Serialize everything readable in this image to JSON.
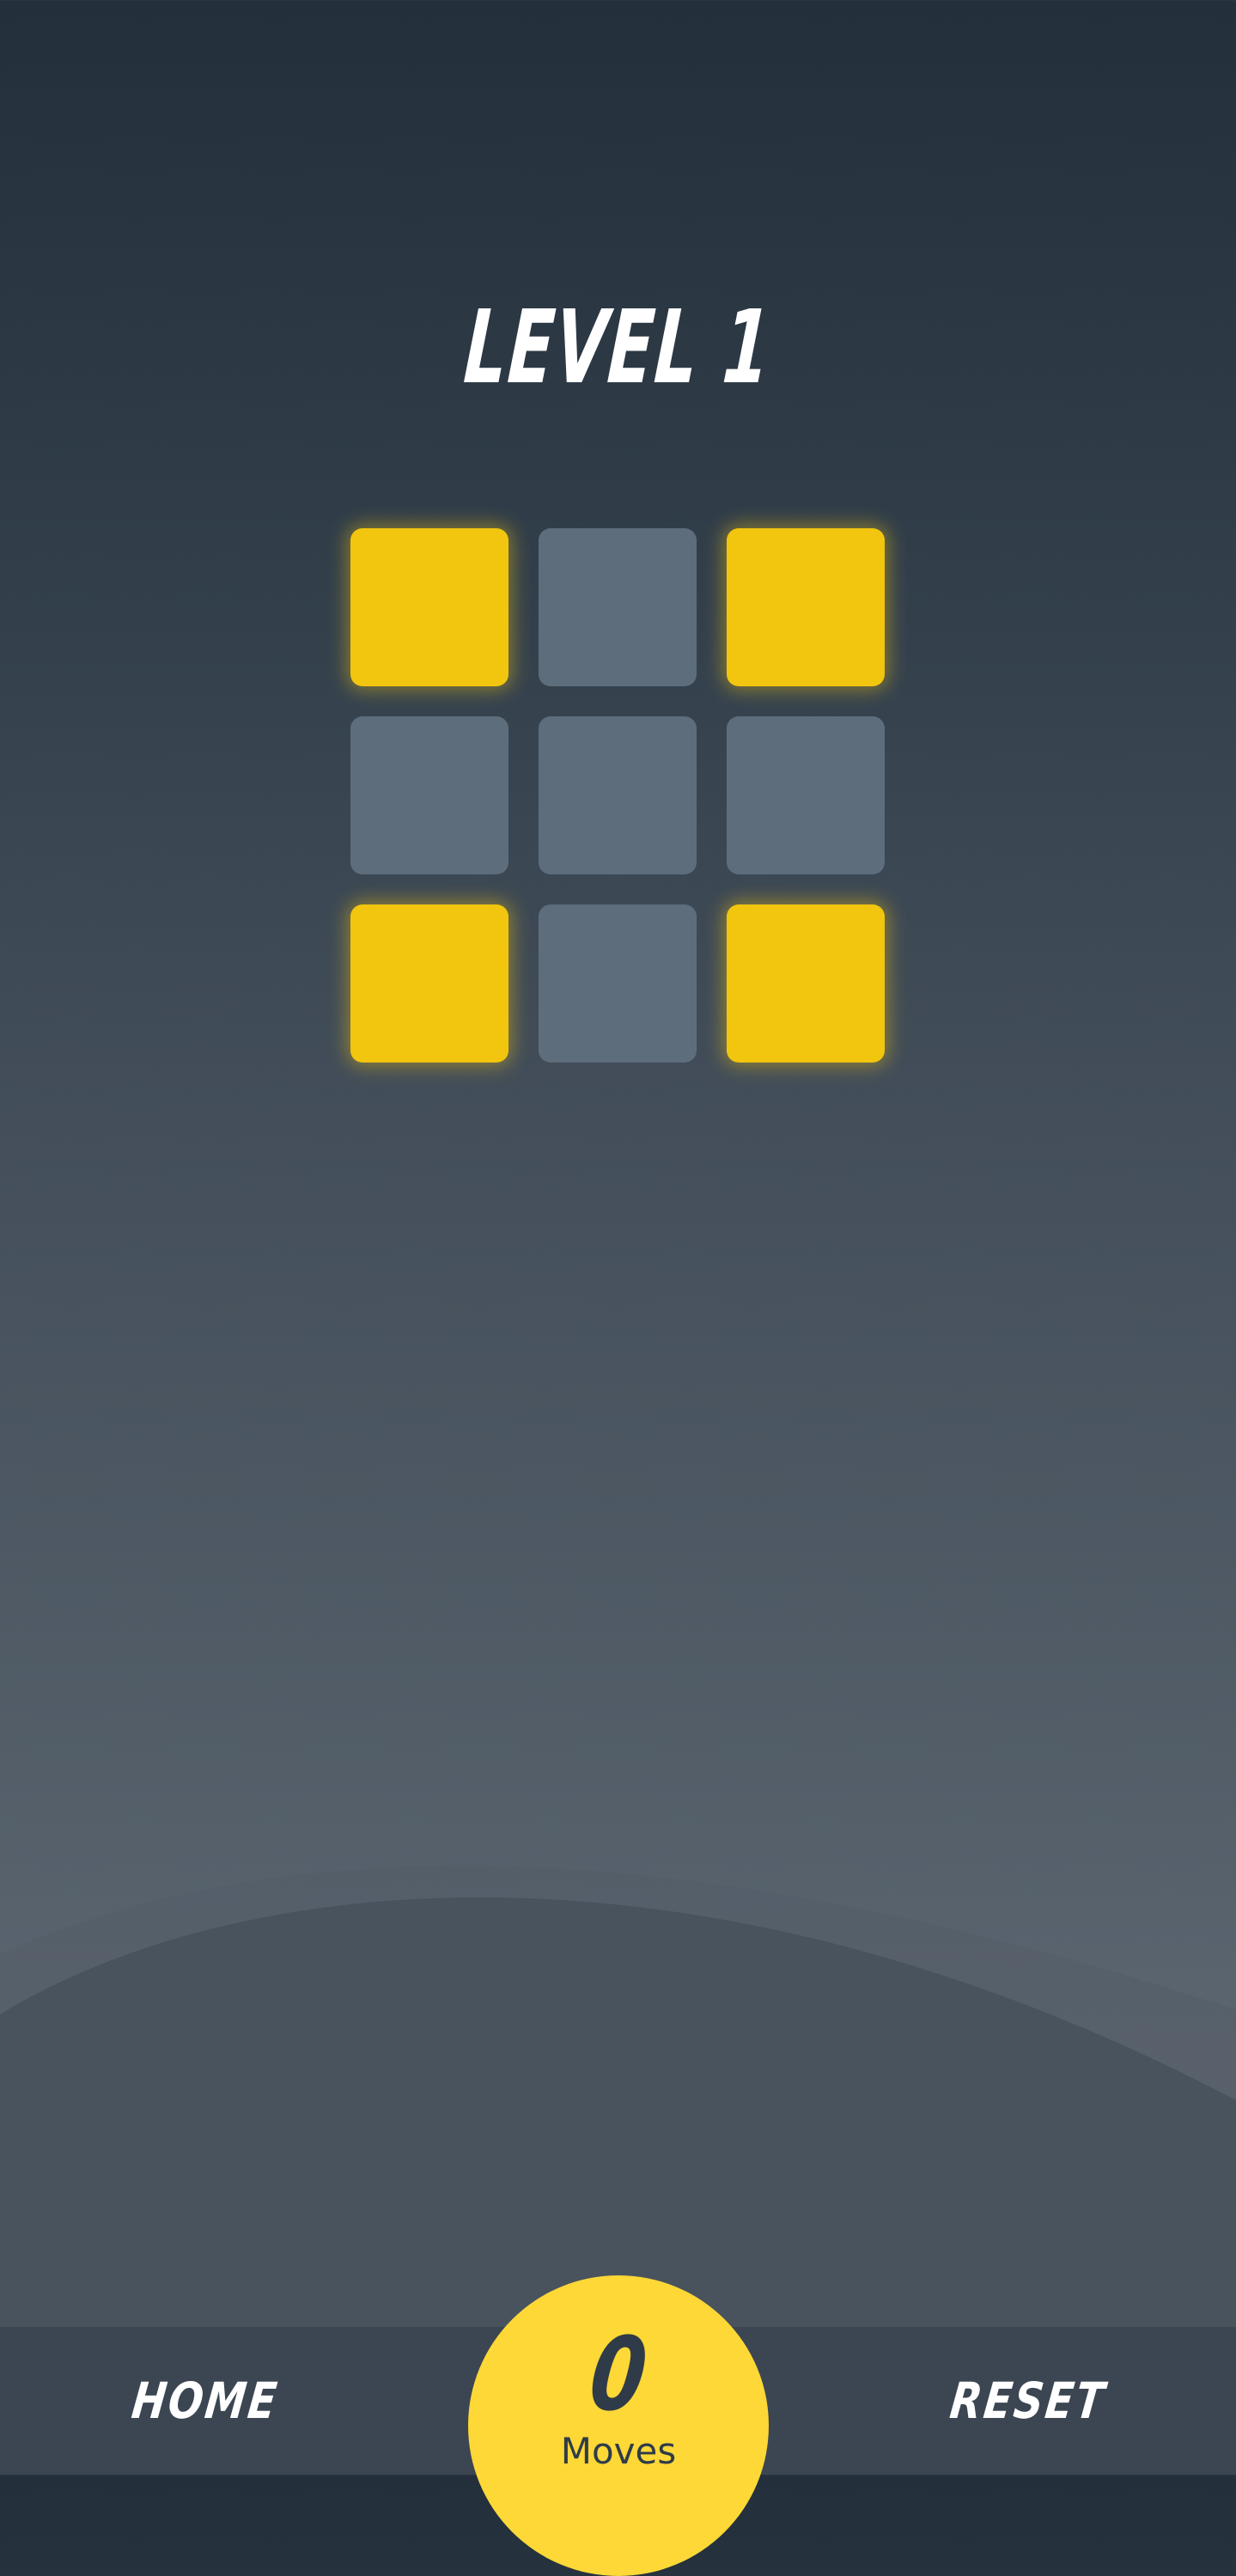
{
  "title": "LEVEL 1",
  "board": {
    "rows": 3,
    "cols": 3,
    "lit": [
      [
        true,
        false,
        true
      ],
      [
        false,
        false,
        false
      ],
      [
        true,
        false,
        true
      ]
    ]
  },
  "footer": {
    "home_label": "HOME",
    "reset_label": "RESET",
    "moves_count": "0",
    "moves_label": "Moves"
  },
  "colors": {
    "tile_on": "#f2c50f",
    "tile_off": "#5e6d7c",
    "moves_badge": "#fdd836",
    "bar": "#3c4652"
  }
}
